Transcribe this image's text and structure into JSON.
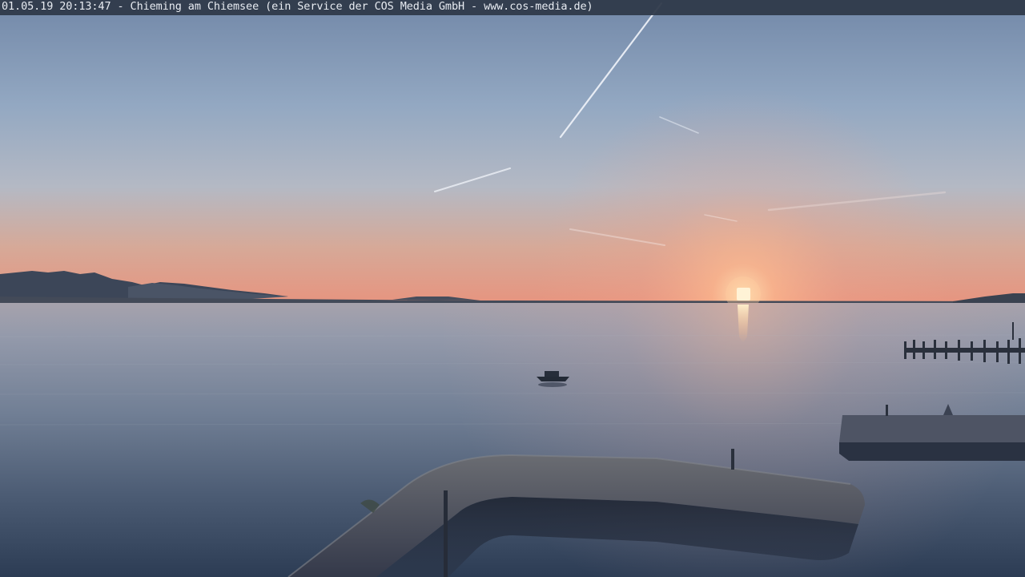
{
  "webcam": {
    "caption": "01.05.19 20:13:47 - Chieming am Chiemsee (ein Service der COS Media GmbH - www.cos-media.de)"
  },
  "palette": {
    "sky_top": "#7d93b4",
    "sky_mid": "#9fb2c8",
    "sky_horizon": "#e8a48a",
    "sun": "#ffd9a8",
    "water_top": "#8d97a9",
    "water_bottom": "#2c3c52",
    "silhouette": "#2c3442",
    "caption_bar": "#2f3a4a"
  },
  "scene": {
    "icons": [
      "sun-icon",
      "boat-icon",
      "pier-icon",
      "breakwater-icon",
      "mountain-icon"
    ]
  }
}
